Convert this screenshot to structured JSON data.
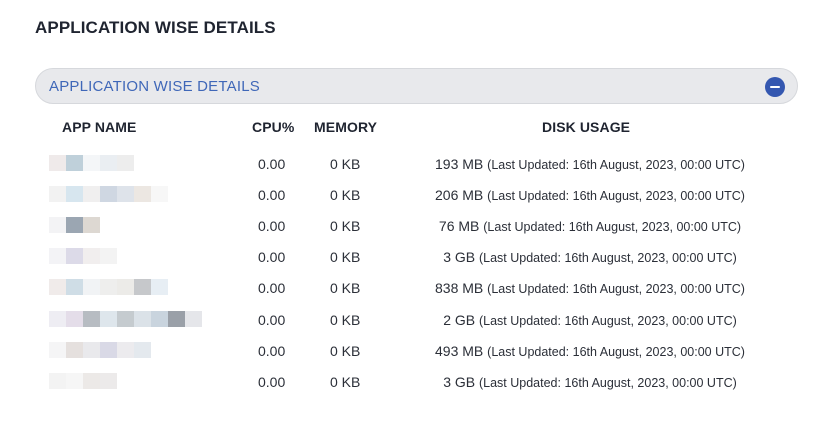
{
  "page_title": "APPLICATION WISE DETAILS",
  "accordion": {
    "title": "APPLICATION WISE DETAILS",
    "state": "expanded",
    "accent_color": "#3f67b8",
    "button_color": "#3457b0",
    "button_icon": "minus-circle-icon"
  },
  "table": {
    "columns": [
      "APP NAME",
      "CPU%",
      "MEMORY",
      "DISK USAGE"
    ],
    "rows": [
      {
        "app_name": "",
        "cpu": "0.00",
        "memory": "0 KB",
        "disk": "193 MB",
        "disk_note": "(Last Updated: 16th August, 2023, 00:00 UTC)"
      },
      {
        "app_name": "",
        "cpu": "0.00",
        "memory": "0 KB",
        "disk": "206 MB",
        "disk_note": "(Last Updated: 16th August, 2023, 00:00 UTC)"
      },
      {
        "app_name": "",
        "cpu": "0.00",
        "memory": "0 KB",
        "disk": "76 MB",
        "disk_note": "(Last Updated: 16th August, 2023, 00:00 UTC)"
      },
      {
        "app_name": "",
        "cpu": "0.00",
        "memory": "0 KB",
        "disk": "3 GB",
        "disk_note": "(Last Updated: 16th August, 2023, 00:00 UTC)"
      },
      {
        "app_name": "",
        "cpu": "0.00",
        "memory": "0 KB",
        "disk": "838 MB",
        "disk_note": "(Last Updated: 16th August, 2023, 00:00 UTC)"
      },
      {
        "app_name": "",
        "cpu": "0.00",
        "memory": "0 KB",
        "disk": "2 GB",
        "disk_note": "(Last Updated: 16th August, 2023, 00:00 UTC)"
      },
      {
        "app_name": "",
        "cpu": "0.00",
        "memory": "0 KB",
        "disk": "493 MB",
        "disk_note": "(Last Updated: 16th August, 2023, 00:00 UTC)"
      },
      {
        "app_name": "",
        "cpu": "0.00",
        "memory": "0 KB",
        "disk": "3 GB",
        "disk_note": "(Last Updated: 16th August, 2023, 00:00 UTC)"
      }
    ]
  }
}
